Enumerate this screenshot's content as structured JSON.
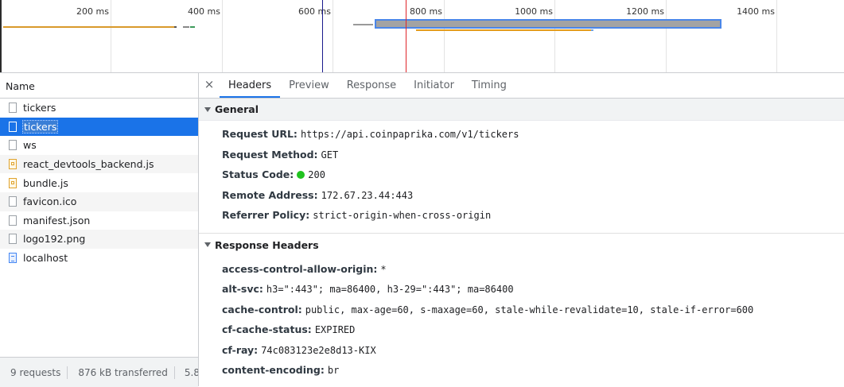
{
  "timeline": {
    "ticks": [
      "200 ms",
      "400 ms",
      "600 ms",
      "800 ms",
      "1000 ms",
      "1200 ms",
      "1400 ms"
    ]
  },
  "request_list": {
    "column_name": "Name",
    "items": [
      {
        "name": "tickers",
        "icon": "document-icon",
        "selected": false
      },
      {
        "name": "tickers",
        "icon": "document-icon",
        "selected": true
      },
      {
        "name": "ws",
        "icon": "document-icon",
        "selected": false
      },
      {
        "name": "react_devtools_backend.js",
        "icon": "script-icon",
        "selected": false
      },
      {
        "name": "bundle.js",
        "icon": "script-icon",
        "selected": false
      },
      {
        "name": "favicon.ico",
        "icon": "document-icon",
        "selected": false
      },
      {
        "name": "manifest.json",
        "icon": "document-icon",
        "selected": false
      },
      {
        "name": "logo192.png",
        "icon": "document-icon",
        "selected": false
      },
      {
        "name": "localhost",
        "icon": "html-doc-icon",
        "selected": false
      }
    ]
  },
  "status_bar": {
    "requests": "9 requests",
    "transferred": "876 kB transferred",
    "resources": "5.8"
  },
  "details": {
    "close_glyph": "×",
    "tabs": [
      "Headers",
      "Preview",
      "Response",
      "Initiator",
      "Timing"
    ],
    "active_tab": "Headers",
    "general": {
      "title": "General",
      "request_url_label": "Request URL:",
      "request_url": "https://api.coinpaprika.com/v1/tickers",
      "request_method_label": "Request Method:",
      "request_method": "GET",
      "status_code_label": "Status Code:",
      "status_code": "200",
      "status_color": "#20c31f",
      "remote_address_label": "Remote Address:",
      "remote_address": "172.67.23.44:443",
      "referrer_policy_label": "Referrer Policy:",
      "referrer_policy": "strict-origin-when-cross-origin"
    },
    "response_headers": {
      "title": "Response Headers",
      "rows": [
        {
          "key": "access-control-allow-origin:",
          "value": "*"
        },
        {
          "key": "alt-svc:",
          "value": "h3=\":443\"; ma=86400, h3-29=\":443\"; ma=86400"
        },
        {
          "key": "cache-control:",
          "value": "public, max-age=60, s-maxage=60, stale-while-revalidate=10, stale-if-error=600"
        },
        {
          "key": "cf-cache-status:",
          "value": "EXPIRED"
        },
        {
          "key": "cf-ray:",
          "value": "74c083123e2e8d13-KIX"
        },
        {
          "key": "content-encoding:",
          "value": "br"
        }
      ]
    }
  },
  "colors": {
    "accent": "#1a73e8",
    "dom_content_loaded_marker": "#1a1a8c",
    "load_marker": "#e0262a",
    "waiting_bar": "#e39c1c",
    "overview_bar": "#9a9a9a"
  }
}
